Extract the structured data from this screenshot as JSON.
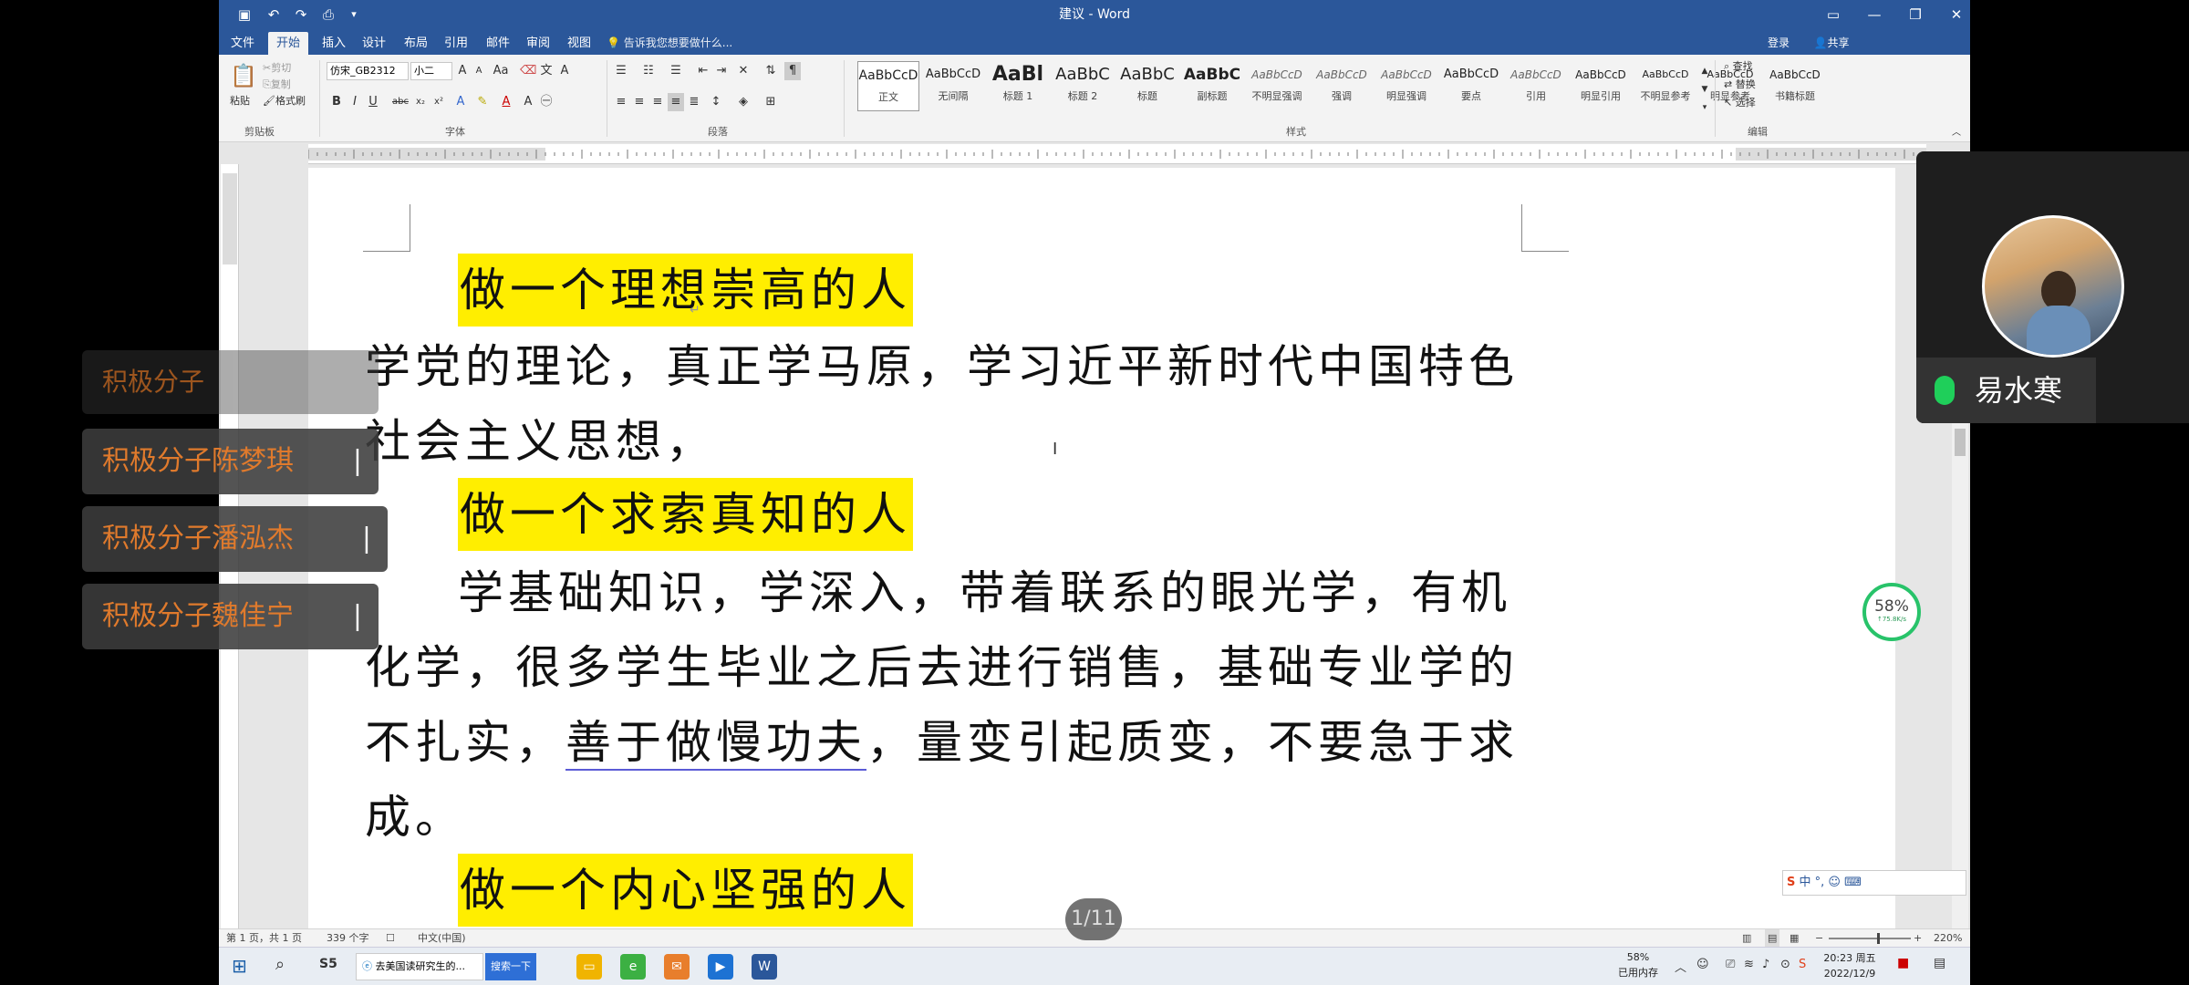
{
  "window": {
    "title": "建议 - Word",
    "login": "登录",
    "share": "共享"
  },
  "tabs": [
    "文件",
    "开始",
    "插入",
    "设计",
    "布局",
    "引用",
    "邮件",
    "审阅",
    "视图"
  ],
  "active_tab": "开始",
  "tell_me": "告诉我您想要做什么...",
  "ribbon": {
    "clipboard": {
      "paste": "粘贴",
      "cut": "剪切",
      "copy": "复制",
      "format_painter": "格式刷",
      "label": "剪贴板"
    },
    "font": {
      "name": "仿宋_GB2312",
      "size": "小二",
      "label": "字体"
    },
    "paragraph": {
      "label": "段落"
    },
    "styles": {
      "label": "样式",
      "items": [
        {
          "sample": "AaBbCcD",
          "name": "正文"
        },
        {
          "sample": "AaBbCcD",
          "name": "无间隔"
        },
        {
          "sample": "AaBl",
          "name": "标题 1"
        },
        {
          "sample": "AaBbC",
          "name": "标题 2"
        },
        {
          "sample": "AaBbC",
          "name": "标题"
        },
        {
          "sample": "AaBbC",
          "name": "副标题"
        },
        {
          "sample": "AaBbCcD",
          "name": "不明显强调"
        },
        {
          "sample": "AaBbCcD",
          "name": "强调"
        },
        {
          "sample": "AaBbCcD",
          "name": "明显强调"
        },
        {
          "sample": "AaBbCcD",
          "name": "要点"
        },
        {
          "sample": "AaBbCcD",
          "name": "引用"
        },
        {
          "sample": "AaBbCcD",
          "name": "明显引用"
        },
        {
          "sample": "AaBbCcD",
          "name": "不明显参考"
        },
        {
          "sample": "AaBbCcD",
          "name": "明显参考"
        },
        {
          "sample": "AaBbCcD",
          "name": "书籍标题"
        }
      ]
    },
    "editing": {
      "find": "查找",
      "replace": "替换",
      "select": "选择",
      "label": "编辑"
    }
  },
  "document": {
    "heading1": "做一个理想崇高的人",
    "para1_line1": "学党的理论，真正学马原，学习近平新时代中国特色",
    "para1_line2": "社会主义思想，",
    "heading2": "做一个求索真知的人",
    "para2_line1": "学基础知识，学深入，带着联系的眼光学，有机",
    "para2_line2": "化学，很多学生毕业之后去进行销售，基础专业学的",
    "para2_line3_a": "不扎实，",
    "para2_line3_b": "善于做慢功夫",
    "para2_line3_c": "，量变引起质变，不要急于求",
    "para2_line4": "成。",
    "heading3": "做一个内心坚强的人"
  },
  "statusbar": {
    "page": "第 1 页，共 1 页",
    "words": "339 个字",
    "language": "中文(中国)",
    "zoom": "220%"
  },
  "overlay": {
    "comments": [
      "积极分子",
      "积极分子陈梦琪",
      "积极分子潘泓杰",
      "积极分子魏佳宁"
    ],
    "speaker_name": "易水寒",
    "memory_percent": "58%",
    "net_speed": "↑75.8K/s",
    "page_badge": "1/11"
  },
  "taskbar": {
    "search_tab": "去美国读研究生的...",
    "search_button": "搜索一下",
    "mem_label": "58%",
    "mem_sub": "已用内存",
    "time": "20:23 周五",
    "date": "2022/12/9"
  },
  "ime": "中 °, ☺ ⌨",
  "colors": {
    "word_blue": "#2b579a",
    "highlight": "#ffee00",
    "comment_text": "#e07a2c"
  }
}
